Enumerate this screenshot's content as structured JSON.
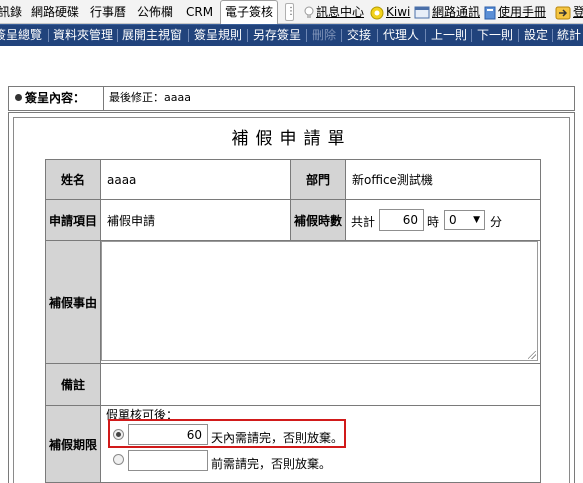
{
  "tabs": {
    "items": [
      "訊錄",
      "網路硬碟",
      "行事曆",
      "公佈欄",
      "CRM",
      "電子簽核"
    ],
    "active": "電子簽核",
    "more": "⋮"
  },
  "quicklinks": {
    "message_center": "訊息中心",
    "kiwi": "Kiwi",
    "network_comm": "網路通訊",
    "manual": "使用手冊",
    "signin": "登"
  },
  "toolbar": {
    "overview": "簽呈總覽",
    "folder": "資料夾管理",
    "expand": "展開主視窗",
    "rules": "簽呈規則",
    "save_as": "另存簽呈",
    "delete": "刪除",
    "submit": "交接",
    "agent": "代理人",
    "prev": "上一則",
    "next": "下一則",
    "settings": "設定",
    "stats": "統計"
  },
  "header": {
    "label": "簽呈內容：",
    "last_modified": "最後修正：aaaa"
  },
  "form": {
    "title": "補假申請單",
    "name_label": "姓名",
    "name_value": "aaaa",
    "dept_label": "部門",
    "dept_value": "新office測試機",
    "item_label": "申請項目",
    "item_value": "補假申請",
    "hours_label": "補假時數",
    "hours_prefix": "共計",
    "hours_value": "60",
    "hours_unit": "時",
    "minutes_value": "0",
    "minutes_unit": "分",
    "reason_label": "補假事由",
    "reason_value": "",
    "note_label": "備註",
    "period_label": "補假期限",
    "period_intro": "假單核可後：",
    "option1_days": "60",
    "option1_suffix": "天內需請完，否則放棄。",
    "option2_value": "",
    "option2_suffix": "前需請完，否則放棄。",
    "selected_option": 1
  },
  "colors": {
    "toolbar_bg": "#21437c",
    "label_bg": "#d4d4d4",
    "highlight": "#d11a1a"
  }
}
